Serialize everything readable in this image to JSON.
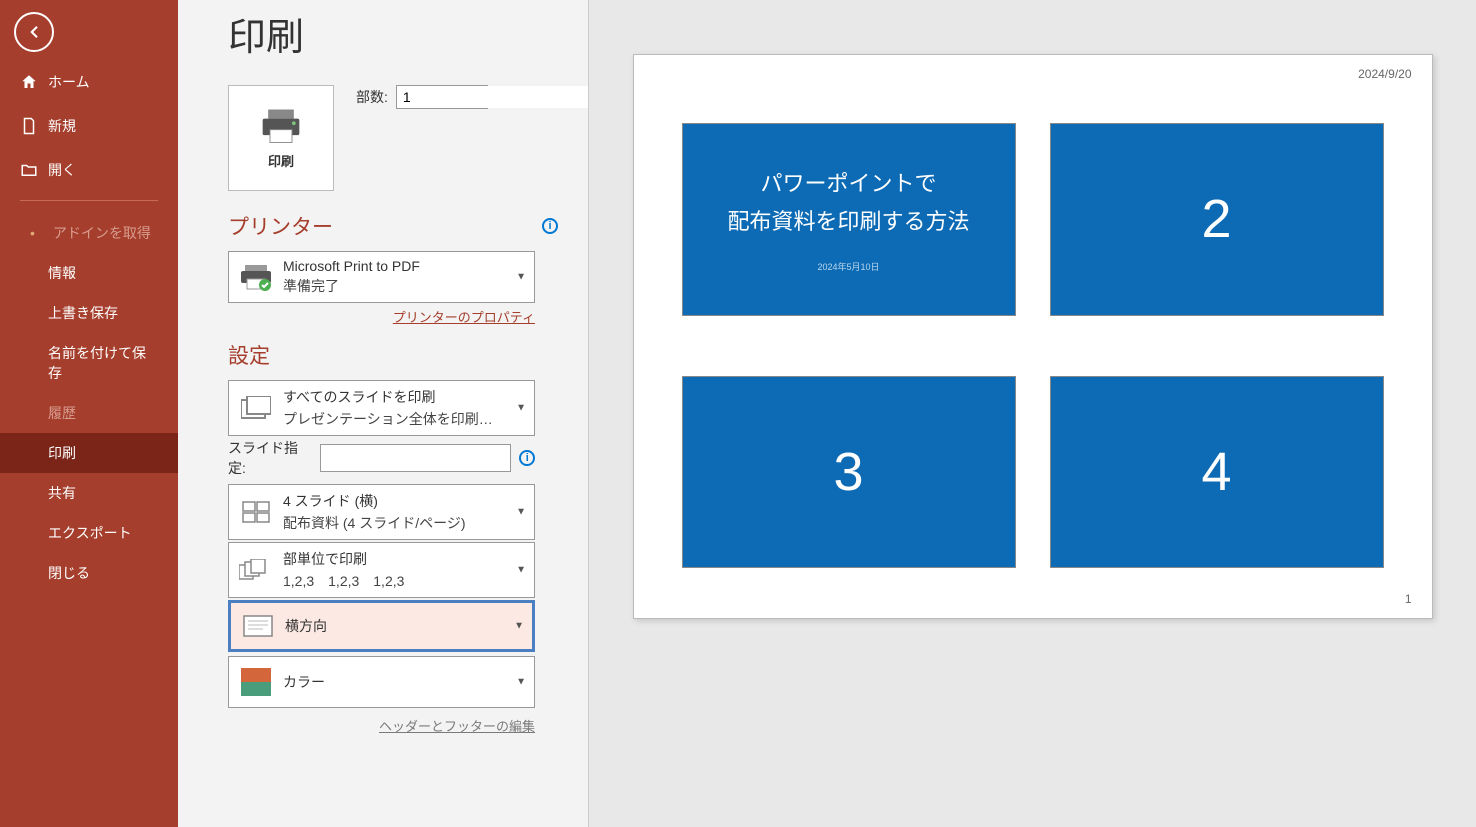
{
  "page_title": "印刷",
  "sidebar": {
    "items": [
      {
        "label": "ホーム",
        "icon": "home"
      },
      {
        "label": "新規",
        "icon": "new"
      },
      {
        "label": "開く",
        "icon": "open"
      }
    ],
    "sub_items": [
      {
        "label": "アドインを取得",
        "dim": true,
        "bullet": true
      },
      {
        "label": "情報"
      },
      {
        "label": "上書き保存"
      },
      {
        "label": "名前を付けて保存"
      },
      {
        "label": "履歴",
        "dim": true
      },
      {
        "label": "印刷",
        "active": true
      },
      {
        "label": "共有"
      },
      {
        "label": "エクスポート"
      },
      {
        "label": "閉じる"
      }
    ]
  },
  "print_button_label": "印刷",
  "copies": {
    "label": "部数:",
    "value": "1"
  },
  "printer_section": "プリンター",
  "printer": {
    "name": "Microsoft Print to PDF",
    "status": "準備完了"
  },
  "printer_props_link": "プリンターのプロパティ",
  "settings_section": "設定",
  "settings": {
    "range": {
      "line1": "すべてのスライドを印刷",
      "line2": "プレゼンテーション全体を印刷…"
    },
    "slide_spec_label": "スライド指定:",
    "slide_spec_value": "",
    "layout": {
      "line1": "4 スライド (横)",
      "line2": "配布資料 (4 スライド/ページ)"
    },
    "collate": {
      "line1": "部単位で印刷",
      "line2": "1,2,3　1,2,3　1,2,3"
    },
    "orientation": {
      "line1": "横方向"
    },
    "color": {
      "line1": "カラー"
    }
  },
  "header_footer_link": "ヘッダーとフッターの編集",
  "preview": {
    "date": "2024/9/20",
    "page_number": "1",
    "slides": [
      {
        "type": "title",
        "line1": "パワーポイントで",
        "line2": "配布資料を印刷する方法",
        "sub": "2024年5月10日"
      },
      {
        "type": "num",
        "value": "2"
      },
      {
        "type": "num",
        "value": "3"
      },
      {
        "type": "num",
        "value": "4"
      }
    ]
  }
}
